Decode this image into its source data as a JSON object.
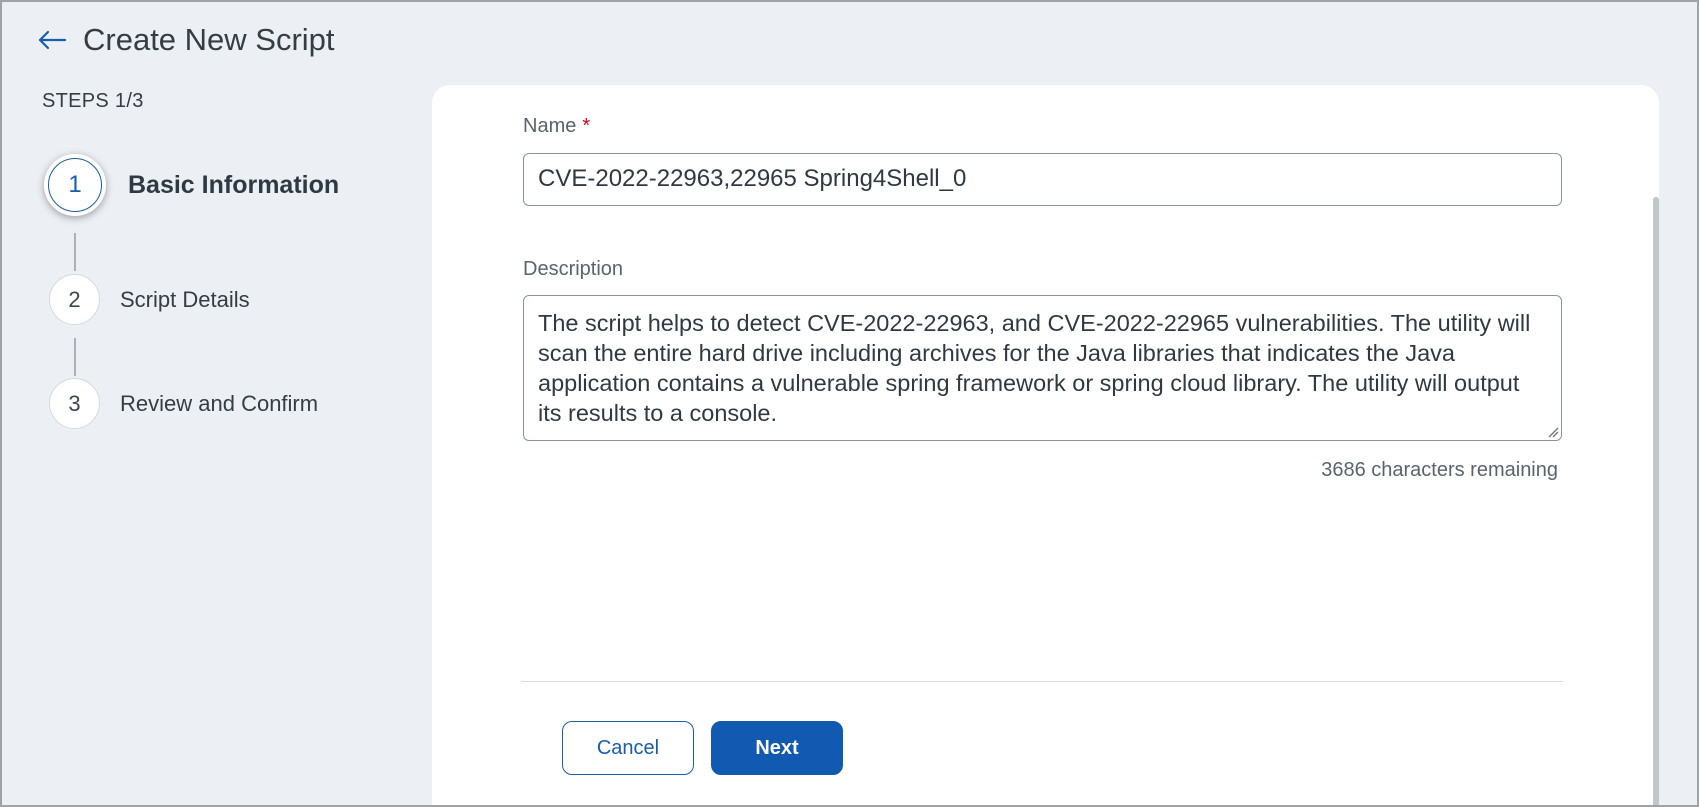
{
  "header": {
    "back_icon": "arrow-left-icon",
    "title": "Create New Script"
  },
  "steps": {
    "label": "STEPS 1/3",
    "items": [
      {
        "number": "1",
        "label": "Basic Information",
        "active": true
      },
      {
        "number": "2",
        "label": "Script Details",
        "active": false
      },
      {
        "number": "3",
        "label": "Review and Confirm",
        "active": false
      }
    ]
  },
  "form": {
    "name_label": "Name",
    "required_mark": "*",
    "name_value": "CVE-2022-22963,22965 Spring4Shell_0",
    "description_label": "Description",
    "description_value": "The script helps to detect CVE-2022-22963, and CVE-2022-22965 vulnerabilities. The utility will scan the entire hard drive including archives for the Java libraries that indicates the Java application contains a vulnerable spring framework or spring cloud library. The utility will output its results to a console.",
    "chars_remaining": "3686 characters remaining"
  },
  "actions": {
    "cancel_label": "Cancel",
    "next_label": "Next"
  },
  "colors": {
    "accent": "#1259b2",
    "background": "#ecf0f5",
    "required": "#d0021b"
  }
}
